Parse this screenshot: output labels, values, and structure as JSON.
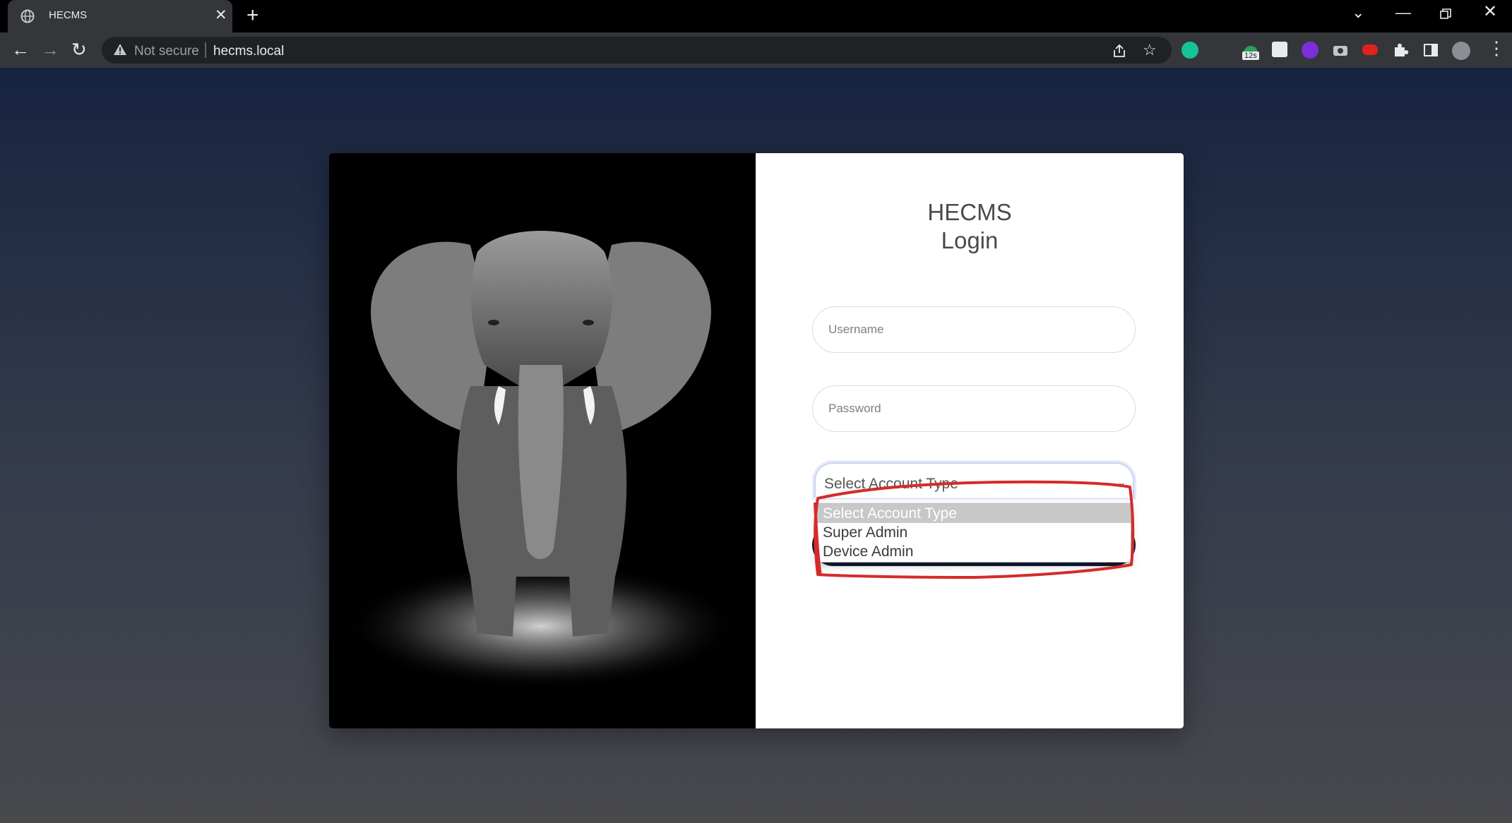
{
  "browser": {
    "tab_title": "HECMS",
    "tab_close": "✕",
    "new_tab": "+",
    "security_label": "Not secure",
    "url": "hecms.local",
    "extension_badge": "12s"
  },
  "login": {
    "title_line1": "HECMS",
    "title_line2": "Login",
    "username_placeholder": "Username",
    "password_placeholder": "Password",
    "account_select_value": "Select Account Type",
    "account_options": [
      "Select Account Type",
      "Super Admin",
      "Device Admin"
    ]
  },
  "colors": {
    "page_gradient_top": "#172440",
    "page_gradient_bottom": "#48494d",
    "submit_button": "#0f1a33",
    "annotation_red": "#d62a2a"
  }
}
